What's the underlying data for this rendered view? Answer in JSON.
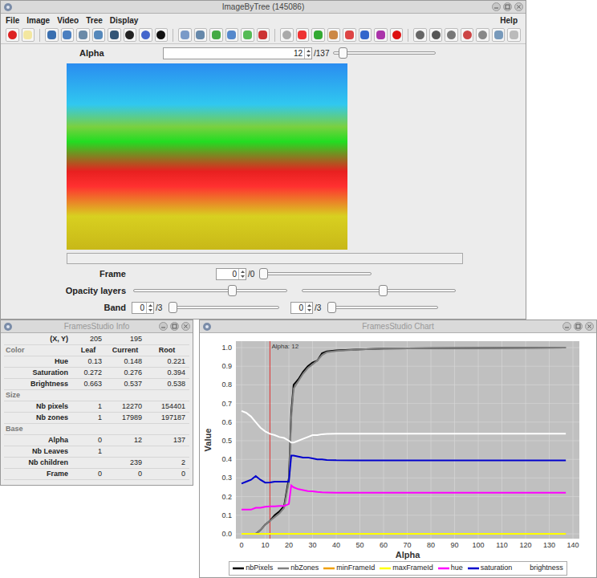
{
  "main_window": {
    "title": "ImageByTree (145086)"
  },
  "menu": [
    "File",
    "Image",
    "Video",
    "Tree",
    "Display"
  ],
  "help_menu": "Help",
  "alpha": {
    "label": "Alpha",
    "value": "12",
    "total": "/137",
    "level": 0.06
  },
  "progress": {
    "level": 0
  },
  "frame": {
    "label": "Frame",
    "value": "0",
    "total": "/0",
    "level": 0
  },
  "opacity": {
    "label": "Opacity layers",
    "levels": [
      0.65,
      0.53
    ]
  },
  "band": {
    "label": "Band",
    "fields": [
      {
        "value": "0",
        "total": "/3",
        "level": 0
      },
      {
        "value": "0",
        "total": "/3",
        "level": 0
      }
    ]
  },
  "info_window": {
    "title": "FramesStudio Info",
    "rows": [
      {
        "kind": "row",
        "label": "(X, Y)",
        "values": [
          "205",
          "195",
          ""
        ]
      },
      {
        "kind": "section",
        "label": "Color",
        "values": [
          "Leaf",
          "Current",
          "Root"
        ]
      },
      {
        "kind": "row",
        "label": "Hue",
        "values": [
          "0.13",
          "0.148",
          "0.221"
        ]
      },
      {
        "kind": "row",
        "label": "Saturation",
        "values": [
          "0.272",
          "0.276",
          "0.394"
        ]
      },
      {
        "kind": "row",
        "label": "Brightness",
        "values": [
          "0.663",
          "0.537",
          "0.538"
        ]
      },
      {
        "kind": "section",
        "label": "Size",
        "values": [
          "",
          "",
          ""
        ]
      },
      {
        "kind": "row",
        "label": "Nb pixels",
        "values": [
          "1",
          "12270",
          "154401"
        ]
      },
      {
        "kind": "row",
        "label": "Nb zones",
        "values": [
          "1",
          "17989",
          "197187"
        ]
      },
      {
        "kind": "section",
        "label": "Base",
        "values": [
          "",
          "",
          ""
        ]
      },
      {
        "kind": "row",
        "label": "Alpha",
        "values": [
          "0",
          "12",
          "137"
        ]
      },
      {
        "kind": "row",
        "label": "Nb Leaves",
        "values": [
          "1",
          "",
          ""
        ]
      },
      {
        "kind": "row",
        "label": "Nb children",
        "values": [
          "",
          "239",
          "2"
        ]
      },
      {
        "kind": "row",
        "label": "Frame",
        "values": [
          "0",
          "0",
          "0"
        ]
      }
    ]
  },
  "chart_window": {
    "title": "FramesStudio Chart",
    "x_label": "Alpha",
    "y_label": "Value",
    "marker": {
      "label": "Alpha: 12",
      "value": 12
    },
    "y_ticks": [
      "0.0",
      "0.1",
      "0.2",
      "0.3",
      "0.4",
      "0.5",
      "0.6",
      "0.7",
      "0.8",
      "0.9",
      "1.0"
    ],
    "x_ticks": [
      "0",
      "10",
      "20",
      "30",
      "40",
      "50",
      "60",
      "70",
      "80",
      "90",
      "100",
      "110",
      "120",
      "130",
      "140"
    ],
    "alpha": [
      0,
      2,
      4,
      6,
      8,
      10,
      12,
      14,
      16,
      18,
      20,
      21,
      22,
      24,
      26,
      28,
      30,
      32,
      34,
      36,
      40,
      50,
      60,
      80,
      100,
      120,
      137
    ],
    "series": [
      {
        "name": "nbPixels",
        "color": "#000000",
        "values": [
          0,
          0,
          0,
          0,
          0.02,
          0.05,
          0.07,
          0.1,
          0.12,
          0.15,
          0.3,
          0.65,
          0.8,
          0.83,
          0.87,
          0.9,
          0.92,
          0.93,
          0.97,
          0.98,
          0.985,
          0.99,
          0.995,
          0.997,
          0.998,
          0.999,
          1.0
        ]
      },
      {
        "name": "nbZones",
        "color": "#808080",
        "values": [
          0,
          0,
          0,
          0,
          0.02,
          0.05,
          0.07,
          0.09,
          0.11,
          0.14,
          0.28,
          0.62,
          0.78,
          0.82,
          0.86,
          0.89,
          0.91,
          0.93,
          0.96,
          0.975,
          0.982,
          0.99,
          0.995,
          0.997,
          0.998,
          0.999,
          1.0
        ]
      },
      {
        "name": "minFrameId",
        "color": "#f0a000",
        "values": [
          0,
          0,
          0,
          0,
          0,
          0,
          0,
          0,
          0,
          0,
          0,
          0,
          0,
          0,
          0,
          0,
          0,
          0,
          0,
          0,
          0,
          0,
          0,
          0,
          0,
          0,
          0
        ]
      },
      {
        "name": "maxFrameId",
        "color": "#ffff00",
        "values": [
          0,
          0,
          0,
          0,
          0,
          0,
          0,
          0,
          0,
          0,
          0,
          0,
          0,
          0,
          0,
          0,
          0,
          0,
          0,
          0,
          0,
          0,
          0,
          0,
          0,
          0,
          0
        ]
      },
      {
        "name": "hue",
        "color": "#ff00ff",
        "values": [
          0.13,
          0.13,
          0.13,
          0.14,
          0.14,
          0.145,
          0.148,
          0.148,
          0.15,
          0.15,
          0.16,
          0.26,
          0.25,
          0.24,
          0.235,
          0.23,
          0.228,
          0.225,
          0.223,
          0.222,
          0.221,
          0.221,
          0.221,
          0.221,
          0.221,
          0.221,
          0.221
        ]
      },
      {
        "name": "saturation",
        "color": "#0000cc",
        "values": [
          0.27,
          0.28,
          0.29,
          0.31,
          0.29,
          0.275,
          0.276,
          0.28,
          0.28,
          0.28,
          0.28,
          0.42,
          0.42,
          0.415,
          0.41,
          0.41,
          0.405,
          0.4,
          0.4,
          0.397,
          0.395,
          0.394,
          0.394,
          0.394,
          0.394,
          0.394,
          0.394
        ]
      },
      {
        "name": "brightness",
        "color": "#ffffff",
        "values": [
          0.66,
          0.65,
          0.63,
          0.6,
          0.57,
          0.55,
          0.537,
          0.53,
          0.52,
          0.515,
          0.5,
          0.49,
          0.49,
          0.5,
          0.51,
          0.52,
          0.53,
          0.53,
          0.535,
          0.537,
          0.538,
          0.538,
          0.538,
          0.538,
          0.538,
          0.538,
          0.538
        ]
      }
    ]
  }
}
